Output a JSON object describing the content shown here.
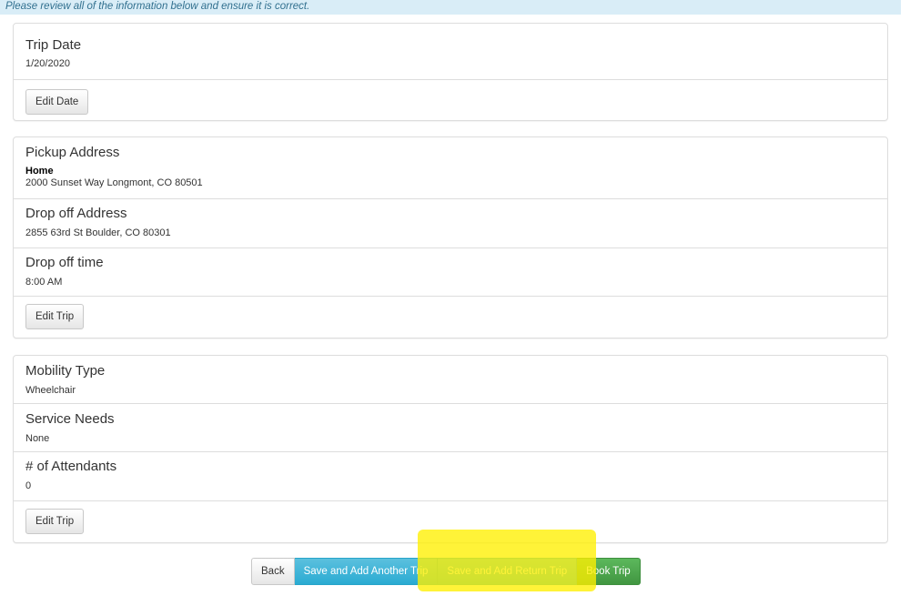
{
  "notice": "Please review all of the information below and ensure it is correct.",
  "trip_date_panel": {
    "title": "Trip Date",
    "value": "1/20/2020",
    "edit_label": "Edit Date"
  },
  "trip_panel": {
    "pickup_title": "Pickup Address",
    "pickup_name": "Home",
    "pickup_address": "2000 Sunset Way Longmont, CO 80501",
    "dropoff_title": "Drop off Address",
    "dropoff_address": "2855 63rd St Boulder, CO 80301",
    "dropoff_time_title": "Drop off time",
    "dropoff_time": "8:00 AM",
    "edit_label": "Edit Trip"
  },
  "needs_panel": {
    "mobility_title": "Mobility Type",
    "mobility_value": "Wheelchair",
    "service_title": "Service Needs",
    "service_value": "None",
    "attendants_title": "# of Attendants",
    "attendants_value": "0",
    "edit_label": "Edit Trip"
  },
  "actions": {
    "back_label": "Back",
    "save_another_label": "Save and Add Another Trip",
    "save_return_label": "Save and Add Return Trip",
    "book_label": "Book Trip"
  },
  "colors": {
    "notice_bg": "#d9edf7",
    "info": "#31b0d5",
    "success": "#449d44",
    "highlight": "#fff000"
  }
}
